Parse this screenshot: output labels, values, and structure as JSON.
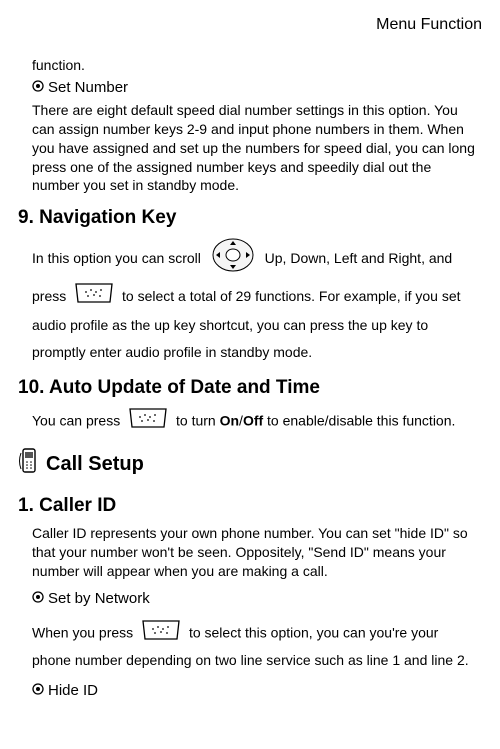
{
  "header": "Menu Function",
  "frag1": "function.",
  "setNumber": {
    "title": "Set Number",
    "body": "There are eight default speed dial number settings in this option. You can assign number keys 2-9 and input phone numbers in them. When you have assigned and set up the numbers for speed dial, you can long press one of the assigned number keys and speedily dial out the number you set in standby mode."
  },
  "navKey": {
    "title": "9. Navigation Key",
    "p1a": "In this option you can scroll",
    "p1b": "Up, Down, Left and Right,",
    "p2a": "and press",
    "p2b": "to select a total of 29 functions. For example, if you set audio profile as the up key shortcut, you can press the up key to promptly enter audio profile in standby mode."
  },
  "autoUpdate": {
    "title": "10. Auto Update of Date and Time",
    "p1a": "You can press",
    "p1b_before": "to turn ",
    "p1b_on": "On",
    "p1b_slash": "/",
    "p1b_off": "Off",
    "p1b_after": " to enable/disable this function."
  },
  "callSetup": {
    "title": "Call Setup"
  },
  "callerID": {
    "title": "1. Caller ID",
    "body": "Caller ID represents your own phone number. You can set \"hide ID\" so that your number won't be seen. Oppositely, \"Send ID\" means your number will appear when you are making a call."
  },
  "setByNetwork": {
    "title": "Set by Network",
    "p1a": "When you press",
    "p1b": "to select this option, you can you're your phone number depending on two line service such as line 1 and line 2."
  },
  "hideID": {
    "title": "Hide ID"
  }
}
